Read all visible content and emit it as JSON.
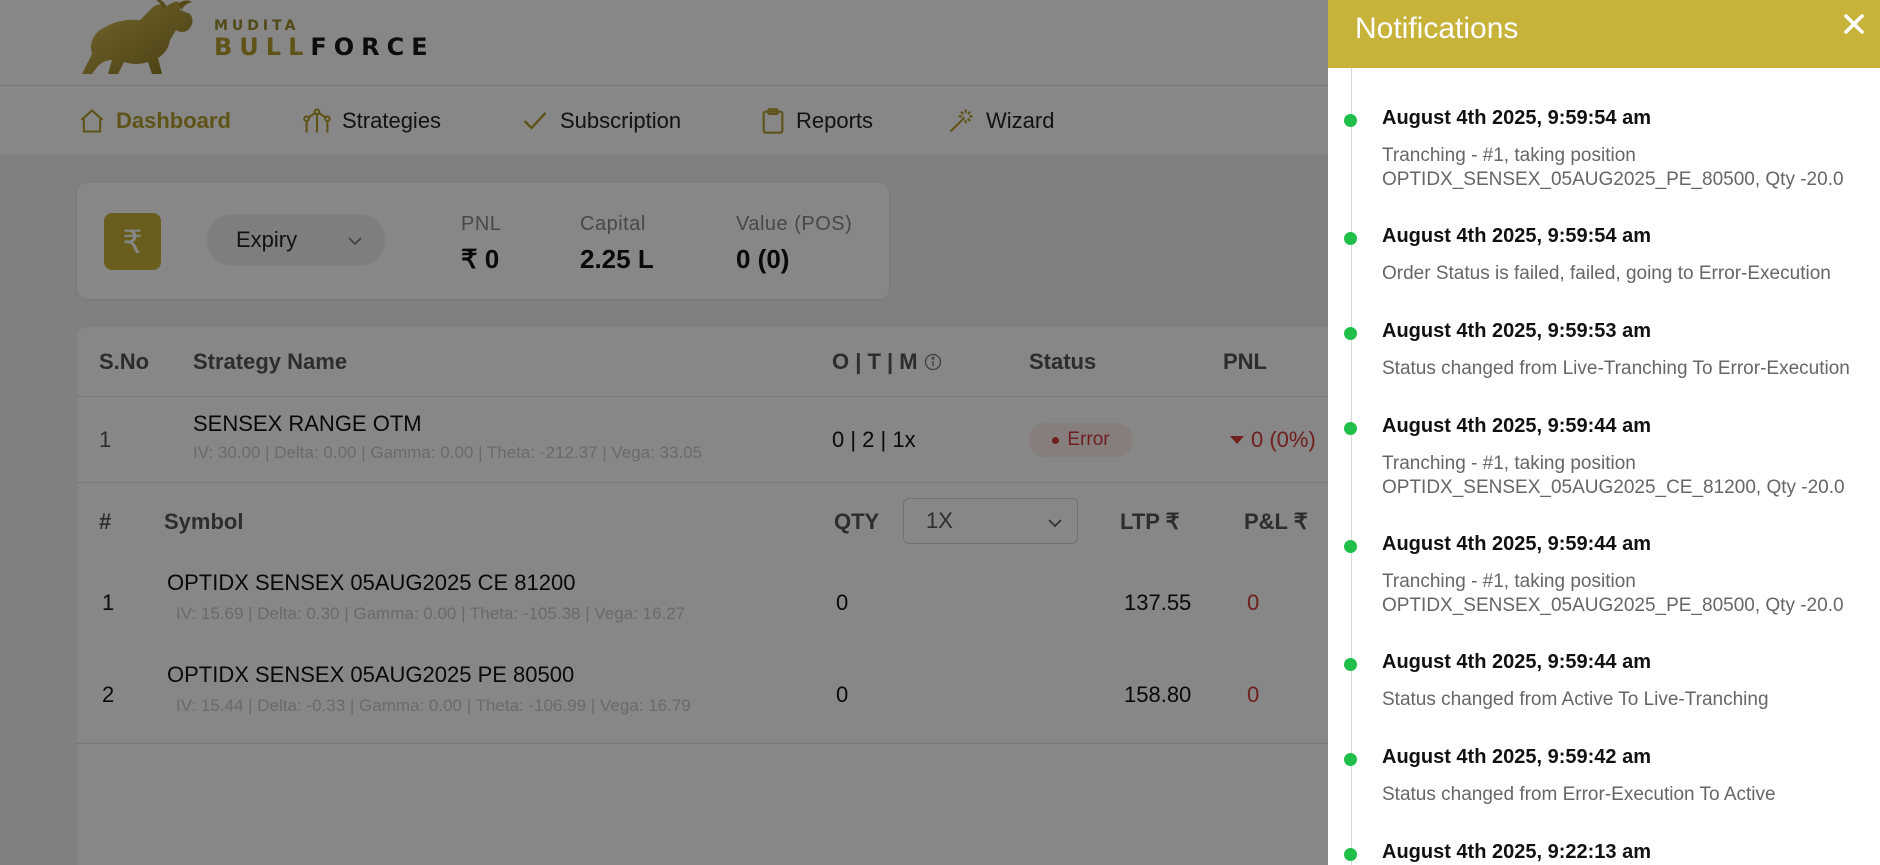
{
  "brand": {
    "top": "MUDITA",
    "bottom_a": "BULL",
    "bottom_b": "FORCE"
  },
  "nav": [
    {
      "label": "Dashboard",
      "icon": "home-icon",
      "active": true
    },
    {
      "label": "Strategies",
      "icon": "strategies-icon",
      "active": false
    },
    {
      "label": "Subscription",
      "icon": "check-icon",
      "active": false
    },
    {
      "label": "Reports",
      "icon": "clipboard-icon",
      "active": false
    },
    {
      "label": "Wizard",
      "icon": "magic-wand-icon",
      "active": false
    }
  ],
  "summary": {
    "currency_symbol": "₹",
    "expiry_label": "Expiry",
    "pnl_label": "PNL",
    "pnl_value": "₹ 0",
    "capital_label": "Capital",
    "capital_value": "2.25 L",
    "value_label": "Value (POS)",
    "value_value": "0 (0)"
  },
  "table": {
    "headers": {
      "sno": "S.No",
      "name": "Strategy Name",
      "otm": "O | T | M",
      "status": "Status",
      "pnl": "PNL"
    },
    "row": {
      "sno": "1",
      "name": "SENSEX RANGE OTM",
      "greeks": "IV: 30.00 | Delta: 0.00 | Gamma: 0.00 | Theta: -212.37 | Vega: 33.05",
      "otm": "0 | 2 | 1x",
      "status": "Error",
      "pnl": "0 (0%)"
    },
    "leg_headers": {
      "num": "#",
      "symbol": "Symbol",
      "qty": "QTY",
      "multiplier": "1X",
      "ltp": "LTP ₹",
      "pl": "P&L ₹"
    },
    "legs": [
      {
        "num": "1",
        "symbol": "OPTIDX SENSEX 05AUG2025 CE 81200",
        "greeks": "IV: 15.69 | Delta: 0.30 | Gamma: 0.00 | Theta: -105.38 | Vega: 16.27",
        "qty": "0",
        "ltp": "137.55",
        "pl": "0"
      },
      {
        "num": "2",
        "symbol": "OPTIDX SENSEX 05AUG2025 PE 80500",
        "greeks": "IV: 15.44 | Delta: -0.33 | Gamma: 0.00 | Theta: -106.99 | Vega: 16.79",
        "qty": "0",
        "ltp": "158.80",
        "pl": "0"
      }
    ]
  },
  "notifications": {
    "title": "Notifications",
    "close_icon": "close-icon",
    "items": [
      {
        "time": "August 4th 2025, 9:59:54 am",
        "message": "Tranching - #1, taking position OPTIDX_SENSEX_05AUG2025_PE_80500, Qty -20.0"
      },
      {
        "time": "August 4th 2025, 9:59:54 am",
        "message": "Order Status is failed, failed, going to Error-Execution"
      },
      {
        "time": "August 4th 2025, 9:59:53 am",
        "message": "Status changed from Live-Tranching To Error-Execution"
      },
      {
        "time": "August 4th 2025, 9:59:44 am",
        "message": "Tranching - #1, taking position OPTIDX_SENSEX_05AUG2025_CE_81200, Qty -20.0"
      },
      {
        "time": "August 4th 2025, 9:59:44 am",
        "message": "Tranching - #1, taking position OPTIDX_SENSEX_05AUG2025_PE_80500, Qty -20.0"
      },
      {
        "time": "August 4th 2025, 9:59:44 am",
        "message": "Status changed from Active To Live-Tranching"
      },
      {
        "time": "August 4th 2025, 9:59:42 am",
        "message": "Status changed from Error-Execution To Active"
      },
      {
        "time": "August 4th 2025, 9:22:13 am",
        "message": ""
      }
    ]
  },
  "colors": {
    "brand_gold": "#c7b23a",
    "error_red": "#d43a3a",
    "timeline_green": "#1fbf4a"
  }
}
